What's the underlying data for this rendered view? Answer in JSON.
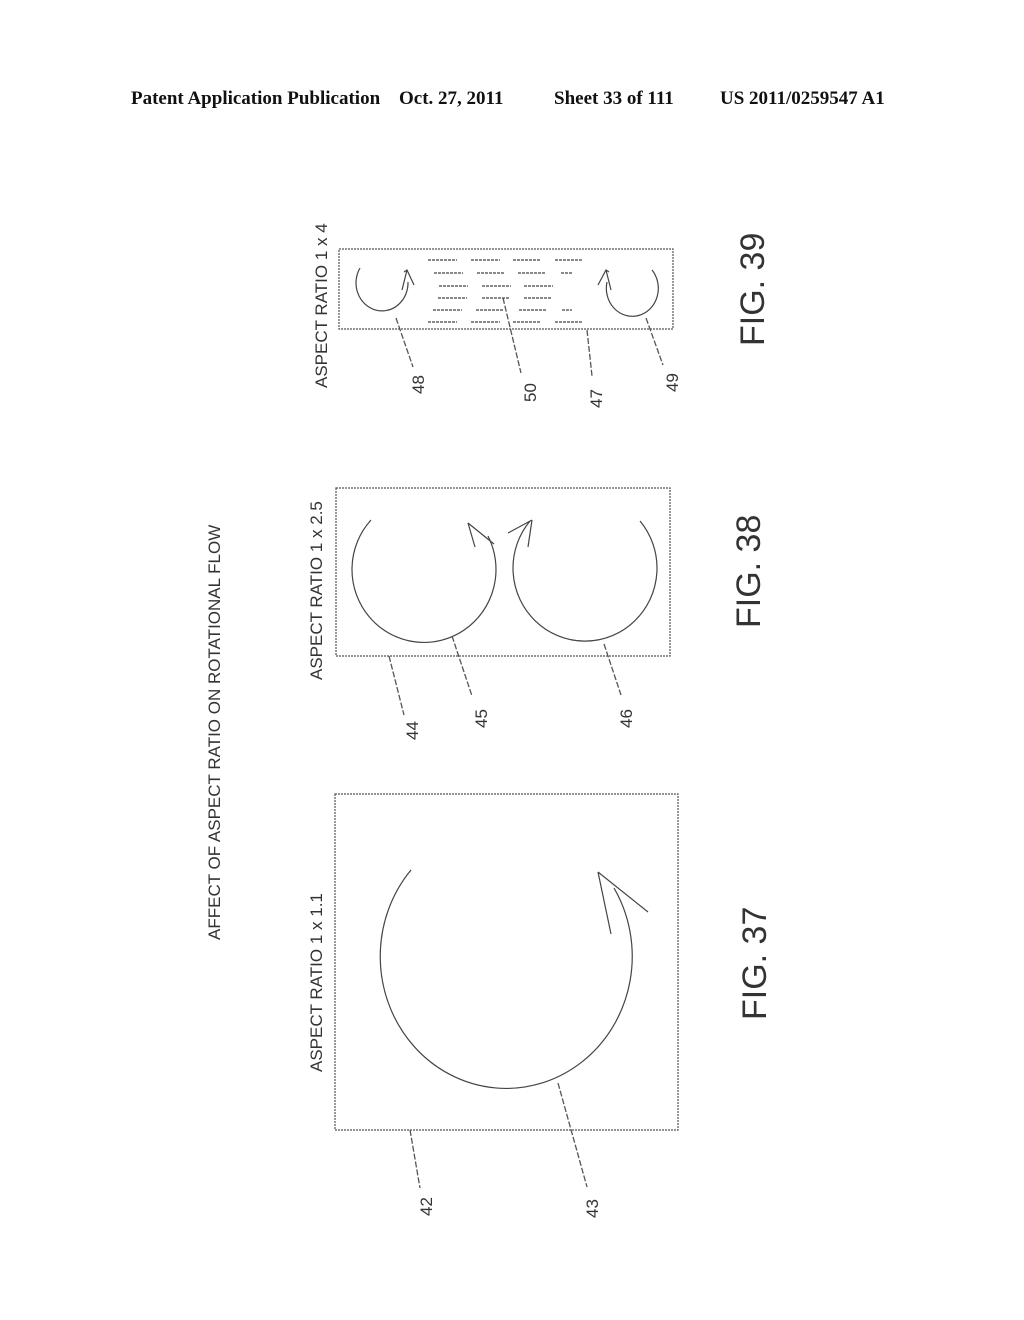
{
  "header": {
    "publication": "Patent Application Publication",
    "date": "Oct. 27, 2011",
    "sheet": "Sheet 33 of 111",
    "number": "US 2011/0259547 A1"
  },
  "title": "AFFECT OF ASPECT RATIO ON ROTATIONAL FLOW",
  "figures": [
    {
      "id": "fig37",
      "caption": "FIG. 37",
      "aspect_label": "ASPECT RATIO 1 x 1.1",
      "refs": {
        "box": "42",
        "flow": "43"
      }
    },
    {
      "id": "fig38",
      "caption": "FIG. 38",
      "aspect_label": "ASPECT RATIO 1 x 2.5",
      "refs": {
        "box": "44",
        "flow_left": "45",
        "flow_right": "46"
      }
    },
    {
      "id": "fig39",
      "caption": "FIG. 39",
      "aspect_label": "ASPECT RATIO 1 x 4",
      "refs": {
        "box": "47",
        "flow_left": "48",
        "flow_right": "49",
        "center": "50"
      }
    }
  ]
}
